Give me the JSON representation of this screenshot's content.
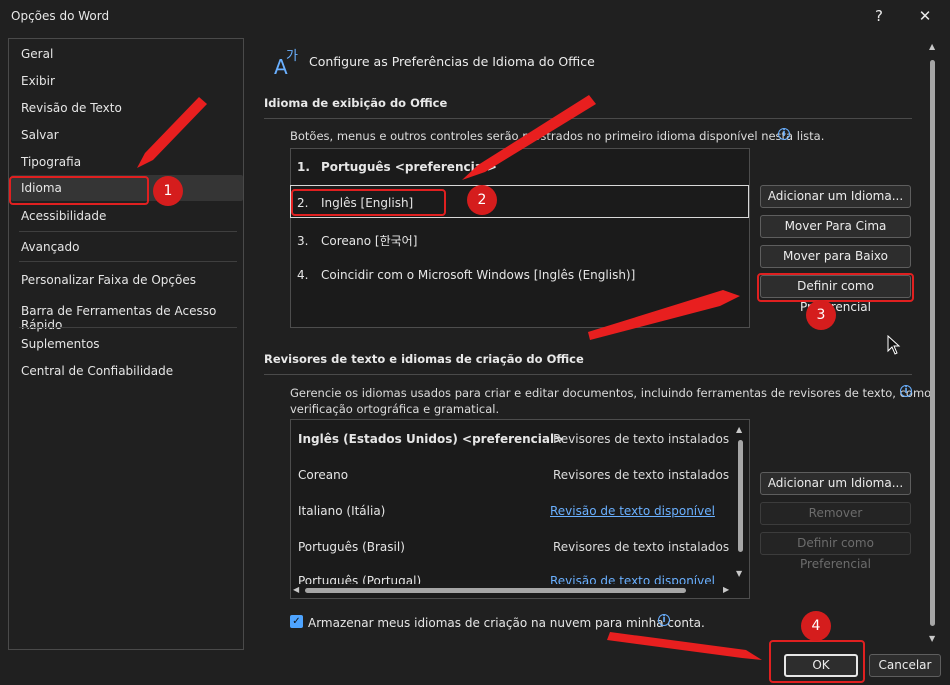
{
  "window": {
    "title": "Opções do Word",
    "help": "?",
    "close": "✕"
  },
  "sidebar": {
    "items": [
      {
        "label": "Geral"
      },
      {
        "label": "Exibir"
      },
      {
        "label": "Revisão de Texto"
      },
      {
        "label": "Salvar"
      },
      {
        "label": "Tipografia"
      },
      {
        "label": "Idioma",
        "selected": true
      },
      {
        "label": "Acessibilidade"
      },
      {
        "label": "Avançado"
      },
      {
        "label": "Personalizar Faixa de Opções"
      },
      {
        "label": "Barra de Ferramentas de Acesso Rápido"
      },
      {
        "label": "Suplementos"
      },
      {
        "label": "Central de Confiabilidade"
      }
    ]
  },
  "header": {
    "icon": "language-icon",
    "title": "Configure as Preferências de Idioma do Office"
  },
  "display": {
    "title": "Idioma de exibição do Office",
    "description": "Botões, menus e outros controles serão mostrados no primeiro idioma disponível nesta lista.",
    "languages": [
      {
        "num": "1.",
        "label": "Português <preferencial>"
      },
      {
        "num": "2.",
        "label": "Inglês [English]"
      },
      {
        "num": "3.",
        "label": "Coreano [한국어]"
      },
      {
        "num": "4.",
        "label": "Coincidir com o Microsoft Windows [Inglês (English)]"
      }
    ],
    "buttons": {
      "add": "Adicionar um Idioma...",
      "up": "Mover Para Cima",
      "down": "Mover para Baixo",
      "preferred": "Definir como Preferencial"
    }
  },
  "proofing": {
    "title": "Revisores de texto e idiomas de criação do Office",
    "description_line1": "Gerencie os idiomas usados para criar e editar documentos, incluindo ferramentas de revisores de texto, como",
    "description_line2": "verificação ortográfica e gramatical.",
    "rows": [
      {
        "lang": "Inglês (Estados Unidos) <preferencial>",
        "status": "Revisores de texto instalados"
      },
      {
        "lang": "Coreano",
        "status": "Revisores de texto instalados"
      },
      {
        "lang": "Italiano (Itália)",
        "status": "Revisão de texto disponível"
      },
      {
        "lang": "Português (Brasil)",
        "status": "Revisores de texto instalados"
      },
      {
        "lang": "Português (Portugal)",
        "status": "Revisão de texto disponível"
      }
    ],
    "buttons": {
      "add": "Adicionar um Idioma...",
      "remove": "Remover",
      "preferred": "Definir como Preferencial"
    },
    "cloud_checkbox": "Armazenar meus idiomas de criação na nuvem para minha conta.",
    "cloud_checked": true
  },
  "footer": {
    "ok": "OK",
    "cancel": "Cancelar"
  },
  "annotations": {
    "badges": [
      "1",
      "2",
      "3",
      "4"
    ],
    "color": "#d51d1d"
  },
  "colors": {
    "background": "#202020",
    "accent": "#4ea4ff",
    "annotation": "#e02020"
  }
}
